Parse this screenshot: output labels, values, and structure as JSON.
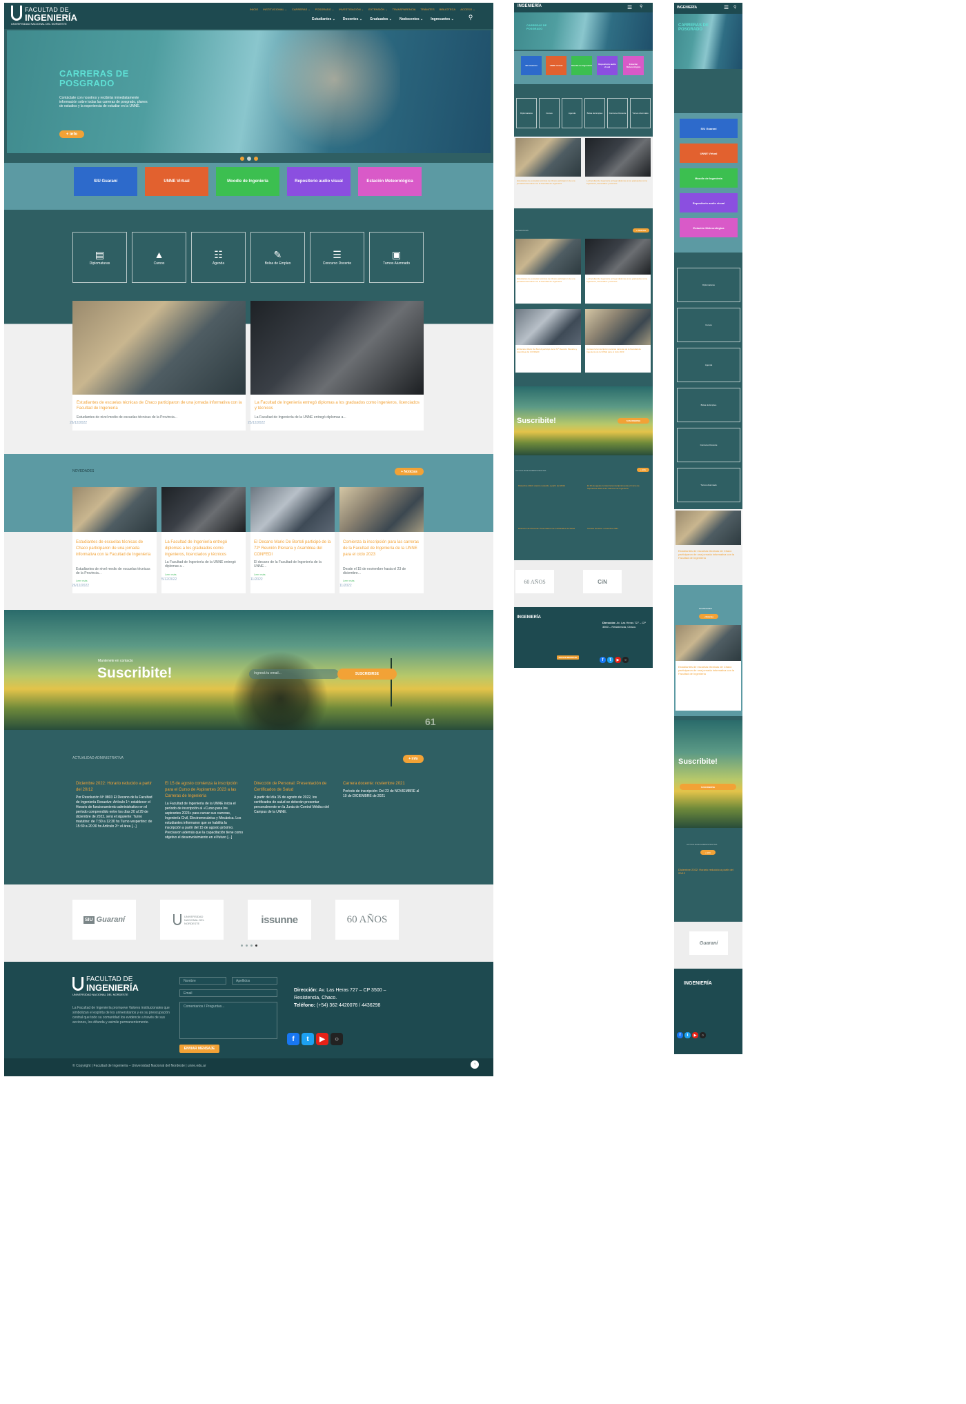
{
  "header": {
    "logo_line1": "FACULTAD DE",
    "logo_line2": "INGENIERÍA",
    "logo_line3": "UNIVERSIDAD NACIONAL DEL NORDESTE",
    "top_nav": [
      "INICIO",
      "INSTITUCIONAL ⌄",
      "CARRERAS ⌄",
      "POSGRADO ⌄",
      "INVESTIGACIÓN ⌄",
      "EXTENSIÓN ⌄",
      "TRANSPARENCIA",
      "TRÁMITES",
      "BIBLIOTECA",
      "ACCESO ⌄"
    ],
    "main_nav": [
      "Estudiantes ⌄",
      "Docentes ⌄",
      "Graduados ⌄",
      "Nodocentes ⌄",
      "Ingresantes ⌄"
    ]
  },
  "hero": {
    "title_line1": "CARRERAS DE",
    "title_line2": "POSGRADO",
    "text": "Contáctate con nosotros y recibirás inmediatamente información sobre todas las carreras de posgrado, planes de estudios y la experiencia de estudiar en la UNNE.",
    "button": "+ info"
  },
  "quick_buttons": [
    "SIU Guaraní",
    "UNNE Virtual",
    "Moodle de Ingeniería",
    "Repositorio audio visual",
    "Estación Meteorológica"
  ],
  "quick_links": [
    "Diplomaturas",
    "Cursos",
    "Agenda",
    "Bolsa de Empleo",
    "Concurso Docente",
    "Turnos Alumnado"
  ],
  "featured": [
    {
      "title": "Estudiantes de escuelas técnicas de Chaco participaron de una jornada informativa con la Facultad de Ingeniería",
      "excerpt": "Estudiantes de nivel medio de escuelas técnicas de la Provincia...",
      "date": "26/12/2022"
    },
    {
      "title": "La Facultad de Ingeniería entregó diplomas a los graduados como ingenieros, licenciados y técnicos",
      "excerpt": "La Facultad de Ingeniería de la UNNE entregó diplomas a...",
      "date": "25/12/2022"
    }
  ],
  "novedades": {
    "heading": "NOVEDADES",
    "button": "+ Noticias",
    "items": [
      {
        "title": "Estudiantes de escuelas técnicas de Chaco participaron de una jornada informativa con la Facultad de Ingeniería",
        "excerpt": "Estudiantes de nivel medio de escuelas técnicas de la Provincia...",
        "read_more": "Leer más",
        "date": "26/12/2022"
      },
      {
        "title": "La Facultad de Ingeniería entregó diplomas a los graduados como ingenieros, licenciados y técnicos",
        "excerpt": "La Facultad de Ingeniería de la UNNE entregó diplomas a...",
        "read_more": "Leer más",
        "date": "5/12/2022"
      },
      {
        "title": "El Decano Mario De Bortoli participó de la 72º Reunión Plenaria y Asamblea del CONFEDI",
        "excerpt": "El decano de la Facultad de Ingeniería de la UNNE...",
        "read_more": "Leer más",
        "date": "11/2022"
      },
      {
        "title": "Comienza la inscripción para las carreras de la Facultad de Ingeniería de la UNNE para el ciclo 2023",
        "excerpt": "Desde el 15 de noviembre hasta el 23 de diciembre...",
        "read_more": "Leer más",
        "date": "11/2022"
      }
    ]
  },
  "subscribe": {
    "kicker": "Mantenete en contacto",
    "title": "Suscribite!",
    "placeholder": "Ingresá tu email...",
    "button": "SUSCRIBIRSE",
    "reading": "61"
  },
  "admin": {
    "heading": "ACTUALIDAD ADMINISTRATIVA",
    "button": "+ info",
    "items": [
      {
        "title": "Diciembre 2022: Horario reducido a partir del 20/12",
        "text": "Por Resolución Nº 0803 El Decano de la Facultad de Ingeniería Resuelve: Artículo 1º: establecer el Horario de funcionamiento administrativo en el período comprendido entre los días 20 al 29 de diciembre de 2022, será el siguiente: Turno matutino: de 7:30 a 12:30 hs Turno vespertino: de 15:30 a 20:30 hs Artículo 2º: el área [...]"
      },
      {
        "title": "El 15 de agosto comienza la inscripción para el Curso de Aspirantes 2023 a las Carreras de Ingeniería",
        "text": "La Facultad de Ingeniería de la UNNE inicia el período de inscripción al «Curso para los aspirantes 2023» para cursar sus carreras, Ingeniería Civil, Electromecánica y Mecánica. Los estudiantes informaron que se habilita la inscripción a partir del 15 de agosto próximo. Precisaron además que la capacitación tiene como objetivo el desenvolvimiento en el futuro [...]"
      },
      {
        "title": "Dirección de Personal: Presentación de Certificados de Salud",
        "text": "A partir del día 15 de agosto de 2022, los certificados de salud se deberán presentar personalmente en la Junta de Control Médico del Campus de la UNNE."
      },
      {
        "title": "Carrera docente: noviembre 2021",
        "text": "Período de inscripción: Del 23 de NOVIEMBRE al 10 de DICIEMBRE de 2021"
      }
    ]
  },
  "partners": [
    "Guaraní",
    "UNIVERSIDAD NACIONAL DEL NORDESTE",
    "issunne",
    "60 AÑOS",
    "CiN"
  ],
  "footer": {
    "logo_line1": "FACULTAD DE",
    "logo_line2": "INGENIERÍA",
    "logo_line3": "UNIVERSIDAD NACIONAL DEL NORDESTE",
    "description": "La Facultad de Ingeniería promueve Valores institucionales que simbolizan el espíritu de los universitarios y es su preocupación central que todo su comunidad los evidencie a través de sus acciones, los difunda y asimile permanentemente.",
    "form": {
      "name": "Nombre",
      "lastname": "Apellidos",
      "email": "Email",
      "message": "Comentarios / Preguntas...",
      "send": "ENVIAR MENSAJE"
    },
    "address_label": "Dirección:",
    "address": "Av. Las Heras 727 – CP 3500 – Resistencia, Chaco.",
    "phone_label": "Teléfono:",
    "phone": "(+54) 362 4420076 / 4436298",
    "copyright": "© Copyright | Facultad de Ingeniería – Universidad Nacional del Nordeste | unne.edu.ar"
  }
}
